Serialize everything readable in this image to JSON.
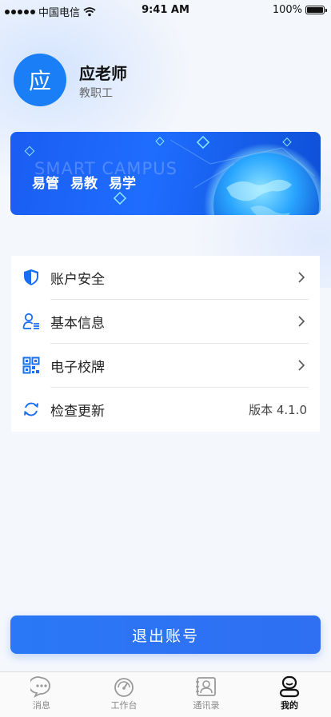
{
  "status_bar": {
    "carrier": "中国电信",
    "time": "9:41 AM",
    "battery": "100%"
  },
  "profile": {
    "avatar_char": "应",
    "name": "应老师",
    "role": "教职工"
  },
  "banner": {
    "watermark": "SMART CAMPUS",
    "slogans": [
      "易管",
      "易教",
      "易学"
    ]
  },
  "menu": {
    "items": [
      {
        "label": "账户安全",
        "icon": "shield-icon"
      },
      {
        "label": "基本信息",
        "icon": "user-info-icon"
      },
      {
        "label": "电子校牌",
        "icon": "qr-code-icon"
      },
      {
        "label": "检查更新",
        "icon": "refresh-icon",
        "value": "版本 4.1.0"
      }
    ]
  },
  "logout_label": "退出账号",
  "tabbar": {
    "tabs": [
      {
        "label": "消息",
        "icon": "message-icon"
      },
      {
        "label": "工作台",
        "icon": "dashboard-icon"
      },
      {
        "label": "通讯录",
        "icon": "contacts-icon"
      },
      {
        "label": "我的",
        "icon": "profile-icon",
        "active": true
      }
    ]
  },
  "colors": {
    "accent": "#1a7ff6",
    "background": "#f4f7fc"
  }
}
